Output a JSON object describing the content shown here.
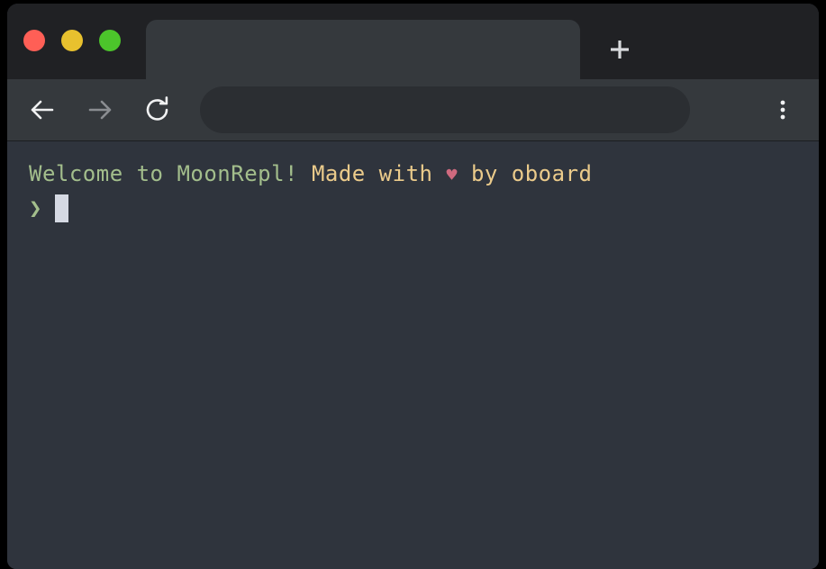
{
  "window": {
    "traffic_lights": [
      {
        "name": "close",
        "color": "#ff5f56"
      },
      {
        "name": "minimize",
        "color": "#e8c12e"
      },
      {
        "name": "maximize",
        "color": "#4cc52b"
      }
    ]
  },
  "tabstrip": {
    "active_tab_title": "",
    "new_tab_label": "+",
    "new_tab_icon": "plus-icon"
  },
  "toolbar": {
    "back_icon": "arrow-left-icon",
    "forward_icon": "arrow-right-icon",
    "reload_icon": "reload-icon",
    "menu_icon": "kebab-menu-icon",
    "address_value": "",
    "address_placeholder": ""
  },
  "terminal": {
    "welcome": {
      "greeting": "Welcome to MoonRepl!",
      "made_with": "Made with",
      "heart": "♥",
      "credit": "by oboard"
    },
    "prompt": {
      "symbol": "❯",
      "input_value": ""
    },
    "colors": {
      "background": "#2f343d",
      "greeting": "#a3be8c",
      "credit": "#ebcb8b",
      "heart": "#cf6a7f",
      "cursor": "#d5d9e3"
    }
  }
}
